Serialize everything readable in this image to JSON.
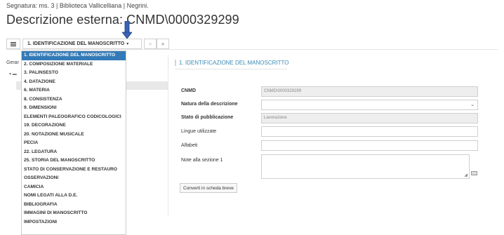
{
  "header": {
    "segnatura": "Segnatura: ms. 3 | Biblioteca Vallicelliana | Negrini.",
    "title": "Descrizione esterna: CNMD\\0000329299"
  },
  "toolbar": {
    "list_icon": "list-icon",
    "section_label": "1. IDENTIFICAZIONE DEL MANOSCRITTO",
    "caret": "▾",
    "prev": "«",
    "next": "»"
  },
  "sidebar": {
    "label": "Gerar",
    "tree_toggle": "▾",
    "tree_folder": "▬"
  },
  "menu": {
    "items": [
      "1. IDENTIFICAZIONE DEL MANOSCRITTO",
      "2. COMPOSIZIONE MATERIALE",
      "3. PALINSESTO",
      "4. DATAZIONE",
      "6. MATERIA",
      "8. CONSISTENZA",
      "9. DIMENSIONI",
      "ELEMENTI PALEOGRAFICO CODICOLOGICI",
      "19. DECORAZIONE",
      "20. NOTAZIONE MUSICALE",
      "PECIA",
      "22. LEGATURA",
      "25. STORIA DEL MANOSCRITTO",
      "STATO DI CONSERVAZIONE E RESTAURO",
      "OSSERVAZIONI",
      "CAMICIA",
      "NOMI LEGATI ALLA D.E.",
      "BIBLIOGRAFIA",
      "IMMAGINI DI MANOSCRITTO",
      "IMPOSTAZIONI"
    ],
    "active_index": 0
  },
  "form": {
    "section_title": "1. IDENTIFICAZIONE DEL MANOSCRITTO",
    "cnmd_label": "CNMD",
    "cnmd_value": "CNMD\\0000329299",
    "natura_label": "Natura della descrizione",
    "natura_value": "",
    "stato_label": "Stato di pubblicazione",
    "stato_value": "Lavorazione",
    "lingue_label": "Lingue utilizzate",
    "lingue_value": "",
    "alfabeti_label": "Alfabeti",
    "alfabeti_value": "",
    "note_label": "Note alla sezione 1",
    "note_value": "",
    "convert_button": "Converti in scheda breve"
  },
  "colors": {
    "active_menu": "#337ab7",
    "section_title": "#3a8ab5",
    "arrow": "#3b63b5"
  }
}
